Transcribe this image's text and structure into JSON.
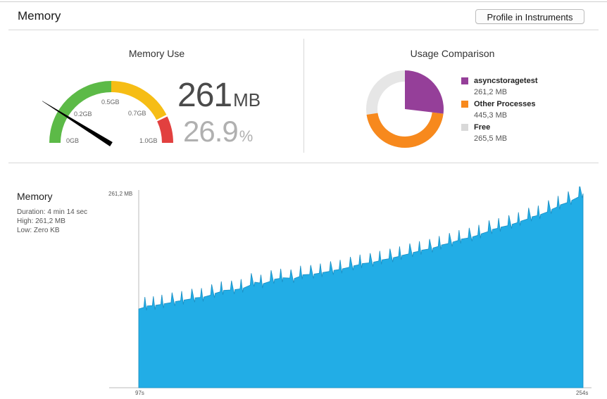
{
  "header": {
    "title": "Memory",
    "profile_button": "Profile in Instruments"
  },
  "memory_use": {
    "title": "Memory Use",
    "value": "261",
    "unit": "MB",
    "percent": "26.9",
    "percent_unit": "%",
    "gauge": {
      "labels": [
        "0GB",
        "0.2GB",
        "0.5GB",
        "0.7GB",
        "1.0GB"
      ],
      "needle_fraction": 0.26,
      "colors": {
        "green": "#5cba47",
        "yellow": "#f6bd15",
        "red": "#e2403f",
        "needle": "#000000"
      }
    }
  },
  "usage_comparison": {
    "title": "Usage Comparison",
    "legend": [
      {
        "name": "asyncstoragetest",
        "value": "261,2 MB",
        "color": "#953f99"
      },
      {
        "name": "Other Processes",
        "value": "445,3 MB",
        "color": "#f7891d"
      },
      {
        "name": "Free",
        "value": "265,5 MB",
        "color": "#d9d9d9"
      }
    ]
  },
  "memory_chart": {
    "title": "Memory",
    "duration": "Duration: 4 min 14 sec",
    "high": "High: 261,2 MB",
    "low": "Low: Zero KB",
    "y_top_label": "261,2 MB",
    "x_start_label": "97s",
    "x_end_label": "254s",
    "color": "#22ade6"
  },
  "chart_data": {
    "type": "area",
    "title": "",
    "xlabel": "",
    "ylabel": "",
    "xlim": [
      97,
      254
    ],
    "ylim": [
      0,
      261.2
    ],
    "x": [
      97,
      100,
      103,
      106,
      110,
      113,
      117,
      120,
      124,
      127,
      131,
      134,
      138,
      141,
      145,
      148,
      152,
      155,
      159,
      162,
      166,
      169,
      173,
      176,
      180,
      183,
      187,
      190,
      194,
      197,
      201,
      204,
      208,
      211,
      215,
      218,
      222,
      225,
      229,
      232,
      236,
      239,
      243,
      246,
      250,
      254
    ],
    "series": [
      {
        "values": [
          106,
          110,
          111,
          113,
          116,
          118,
          121,
          122,
          127,
          131,
          132,
          134,
          142,
          140,
          146,
          148,
          147,
          152,
          153,
          155,
          158,
          160,
          164,
          167,
          169,
          172,
          175,
          178,
          182,
          185,
          188,
          192,
          196,
          200,
          203,
          207,
          213,
          216,
          220,
          224,
          230,
          233,
          240,
          246,
          252,
          261.2
        ]
      }
    ]
  }
}
